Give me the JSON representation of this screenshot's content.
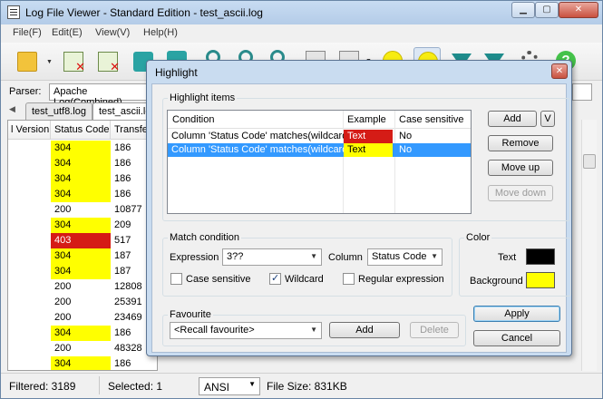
{
  "app": {
    "title": "Log File Viewer - Standard Edition - test_ascii.log"
  },
  "menu": [
    "File(F)",
    "Edit(E)",
    "View(V)",
    "Help(H)"
  ],
  "toolbar": {
    "icons": [
      "open-folder-icon",
      "close-file-icon",
      "close-all-icon",
      "refresh-icon",
      "refresh-all-icon",
      "find-icon",
      "find-next-icon",
      "find-prev-icon",
      "document-icon",
      "document-list-icon",
      "highlight-icon",
      "highlight-active-icon",
      "filter-icon",
      "filter-clear-icon",
      "settings-icon",
      "help-icon"
    ]
  },
  "parser": {
    "label": "Parser:",
    "value": "Apache Log(Combined)"
  },
  "tabs": [
    "test_utf8.log",
    "test_ascii.log"
  ],
  "grid": {
    "columns": [
      "l Version",
      "Status Code",
      "Transfer"
    ],
    "rows": [
      {
        "status": "304",
        "transfer": "186",
        "hl": "yellow"
      },
      {
        "status": "304",
        "transfer": "186",
        "hl": "yellow"
      },
      {
        "status": "304",
        "transfer": "186",
        "hl": "yellow"
      },
      {
        "status": "304",
        "transfer": "186",
        "hl": "yellow"
      },
      {
        "status": "200",
        "transfer": "10877",
        "hl": ""
      },
      {
        "status": "304",
        "transfer": "209",
        "hl": "yellow"
      },
      {
        "status": "403",
        "transfer": "517",
        "hl": "red"
      },
      {
        "status": "304",
        "transfer": "187",
        "hl": "yellow"
      },
      {
        "status": "304",
        "transfer": "187",
        "hl": "yellow"
      },
      {
        "status": "200",
        "transfer": "12808",
        "hl": ""
      },
      {
        "status": "200",
        "transfer": "25391",
        "hl": ""
      },
      {
        "status": "200",
        "transfer": "23469",
        "hl": ""
      },
      {
        "status": "304",
        "transfer": "186",
        "hl": "yellow"
      },
      {
        "status": "200",
        "transfer": "48328",
        "hl": ""
      },
      {
        "status": "304",
        "transfer": "186",
        "hl": "yellow"
      }
    ]
  },
  "status_bar": {
    "filtered": "Filtered: 3189",
    "selected": "Selected: 1",
    "encoding": "ANSI",
    "file_size": "File Size: 831KB"
  },
  "dialog": {
    "title": "Highlight",
    "items_group": "Highlight items",
    "list_headers": [
      "Condition",
      "Example",
      "Case sensitive"
    ],
    "items": [
      {
        "condition": "Column 'Status Code' matches(wildcard)...",
        "example": "Text",
        "case": "No",
        "bg": "#d51c16",
        "fg": "#ffffff",
        "selected": false
      },
      {
        "condition": "Column 'Status Code' matches(wildcard)...",
        "example": "Text",
        "case": "No",
        "bg": "#ffff00",
        "fg": "#000000",
        "selected": true
      }
    ],
    "buttons": {
      "add": "Add",
      "add_dropdown": "V",
      "remove": "Remove",
      "move_up": "Move up",
      "move_down": "Move down"
    },
    "match": {
      "group": "Match condition",
      "expression_label": "Expression",
      "expression_value": "3??",
      "column_label": "Column",
      "column_value": "Status Code",
      "case_sensitive": "Case sensitive",
      "case_sensitive_checked": false,
      "wildcard": "Wildcard",
      "wildcard_checked": true,
      "regex": "Regular expression",
      "regex_checked": false
    },
    "color": {
      "group": "Color",
      "text_label": "Text",
      "text_color": "#000000",
      "background_label": "Background",
      "background_color": "#ffff00"
    },
    "favourite": {
      "group": "Favourite",
      "recall": "<Recall favourite>",
      "add": "Add",
      "delete": "Delete"
    },
    "apply": "Apply",
    "cancel": "Cancel"
  }
}
